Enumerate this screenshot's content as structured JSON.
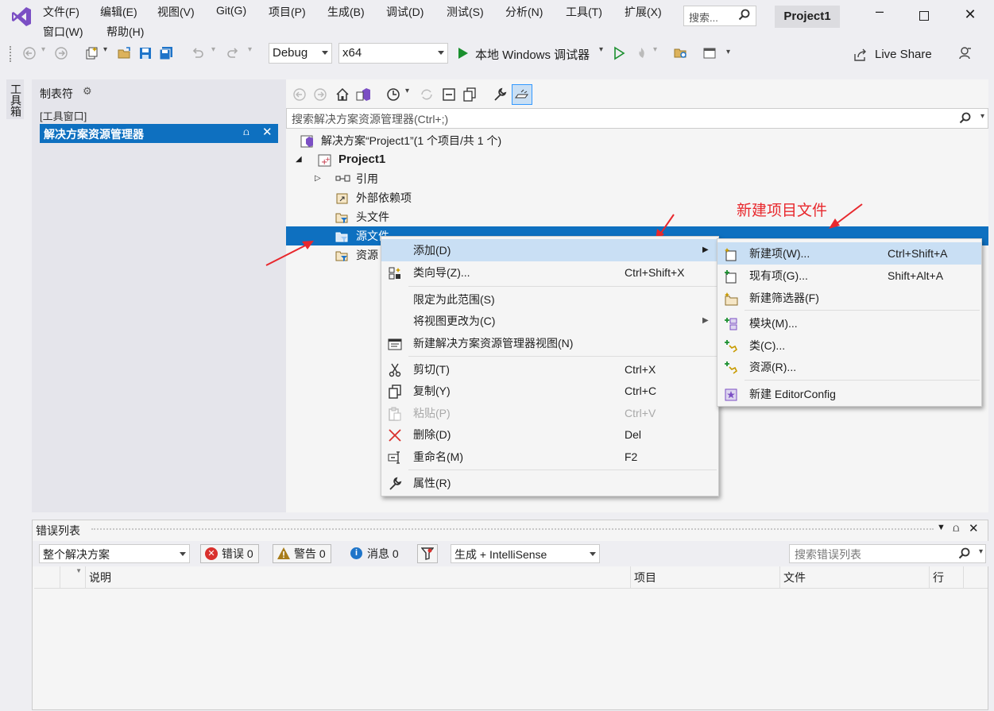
{
  "menubar": {
    "row1": [
      "文件(F)",
      "编辑(E)",
      "视图(V)",
      "Git(G)",
      "项目(P)",
      "生成(B)",
      "调试(D)",
      "测试(S)",
      "分析(N)",
      "工具(T)",
      "扩展(X)"
    ],
    "row2": [
      "窗口(W)",
      "帮助(H)"
    ],
    "search_placeholder": "搜索...",
    "project_name": "Project1"
  },
  "toolbar": {
    "config": "Debug",
    "platform": "x64",
    "run_label": "本地 Windows 调试器",
    "live_share": "Live Share"
  },
  "toolbox_strip": "工具箱",
  "properties": {
    "title": "制表符",
    "tool_window": "[工具窗口]",
    "selected": "解决方案资源管理器"
  },
  "solution_explorer": {
    "search_placeholder": "搜索解决方案资源管理器(Ctrl+;)",
    "solution": "解决方案“Project1”(1 个项目/共 1 个)",
    "project": "Project1",
    "items": [
      "引用",
      "外部依赖项",
      "头文件",
      "源文件",
      "资源"
    ]
  },
  "context_menu": {
    "items": [
      {
        "label": "添加(D)",
        "shortcut": ""
      },
      {
        "label": "类向导(Z)...",
        "shortcut": "Ctrl+Shift+X"
      },
      {
        "label": "限定为此范围(S)",
        "shortcut": ""
      },
      {
        "label": "将视图更改为(C)",
        "shortcut": ""
      },
      {
        "label": "新建解决方案资源管理器视图(N)",
        "shortcut": ""
      },
      {
        "label": "剪切(T)",
        "shortcut": "Ctrl+X"
      },
      {
        "label": "复制(Y)",
        "shortcut": "Ctrl+C"
      },
      {
        "label": "粘贴(P)",
        "shortcut": "Ctrl+V"
      },
      {
        "label": "删除(D)",
        "shortcut": "Del"
      },
      {
        "label": "重命名(M)",
        "shortcut": "F2"
      },
      {
        "label": "属性(R)",
        "shortcut": ""
      }
    ]
  },
  "submenu": {
    "items": [
      {
        "label": "新建项(W)...",
        "shortcut": "Ctrl+Shift+A"
      },
      {
        "label": "现有项(G)...",
        "shortcut": "Shift+Alt+A"
      },
      {
        "label": "新建筛选器(F)",
        "shortcut": ""
      },
      {
        "label": "模块(M)...",
        "shortcut": ""
      },
      {
        "label": "类(C)...",
        "shortcut": ""
      },
      {
        "label": "资源(R)...",
        "shortcut": ""
      },
      {
        "label": "新建 EditorConfig",
        "shortcut": ""
      }
    ]
  },
  "annotation": "新建项目文件",
  "error_list": {
    "title": "错误列表",
    "scope": "整个解决方案",
    "errors": "错误 0",
    "warnings": "警告 0",
    "messages": "消息 0",
    "build_filter": "生成 + IntelliSense",
    "search_placeholder": "搜索错误列表",
    "columns": [
      "说明",
      "项目",
      "文件",
      "行"
    ]
  },
  "colors": {
    "selection": "#0e70c0",
    "hover": "#c9dff4",
    "annotation": "#e8282d",
    "vs_purple": "#68217a"
  }
}
